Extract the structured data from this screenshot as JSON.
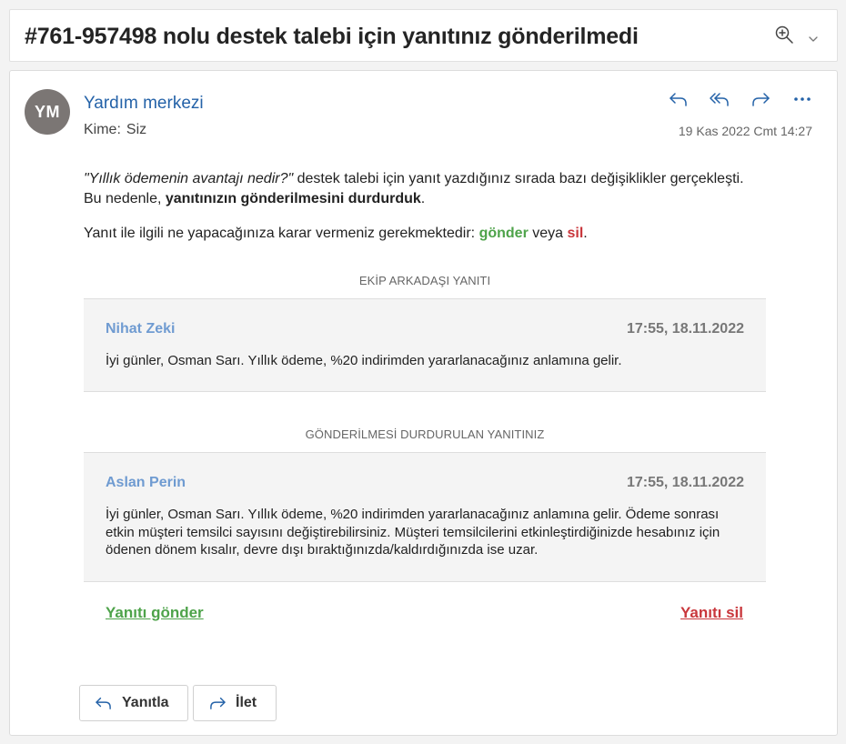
{
  "subject": {
    "title": "#761-957498 nolu destek talebi için yanıtınız gönderilmedi",
    "zoom_icon": "zoom-in-icon",
    "dropdown_icon": "chevron-down-icon"
  },
  "header": {
    "avatar_initials": "YM",
    "sender_name": "Yardım merkezi",
    "to_label": "Kime:",
    "to_value": "Siz",
    "date": "19 Kas 2022 Cmt 14:27",
    "actions": [
      "reply-icon",
      "reply-all-icon",
      "forward-icon",
      "more-icon"
    ]
  },
  "message": {
    "question": "\"Yıllık ödemenin avantajı nedir?\"",
    "p1_text": " destek talebi için yanıt yazdığınız sırada bazı değişiklikler gerçekleşti. Bu nedenle, ",
    "p1_bold": "yanıtınızın gönderilmesini durdurduk",
    "p1_end": ".",
    "p2_text": "Yanıt ile ilgili ne yapacağınıza karar vermeniz gerekmektedir: ",
    "p2_send": "gönder",
    "p2_or": " veya ",
    "p2_delete": "sil",
    "p2_end": "."
  },
  "teammate_reply": {
    "label": "EKİP ARKADAŞI YANITI",
    "name": "Nihat Zeki",
    "time": "17:55, 18.11.2022",
    "text": "İyi günler, Osman Sarı. Yıllık ödeme, %20 indirimden yararlanacağınız anlamına gelir."
  },
  "your_reply": {
    "label": "GÖNDERİLMESİ DURDURULAN YANITINIZ",
    "name": "Aslan Perin",
    "time": "17:55, 18.11.2022",
    "text": "İyi günler, Osman Sarı. Yıllık ödeme, %20 indirimden yararlanacağınız anlamına gelir. Ödeme sonrası etkin müşteri temsilci sayısını değiştirebilirsiniz. Müşteri temsilcilerini etkinleştirdiğinizde hesabınız için ödenen dönem kısalır, devre dışı bıraktığınızda/kaldırdığınızda ise uzar."
  },
  "links": {
    "send": "Yanıtı gönder",
    "delete": "Yanıtı sil"
  },
  "footer": {
    "reply_label": "Yanıtla",
    "forward_label": "İlet"
  },
  "colors": {
    "sender": "#2462a8",
    "send_green": "#4ea34a",
    "delete_red": "#c9373c",
    "card_name": "#6f9bd1",
    "avatar_bg": "#7b7674"
  }
}
